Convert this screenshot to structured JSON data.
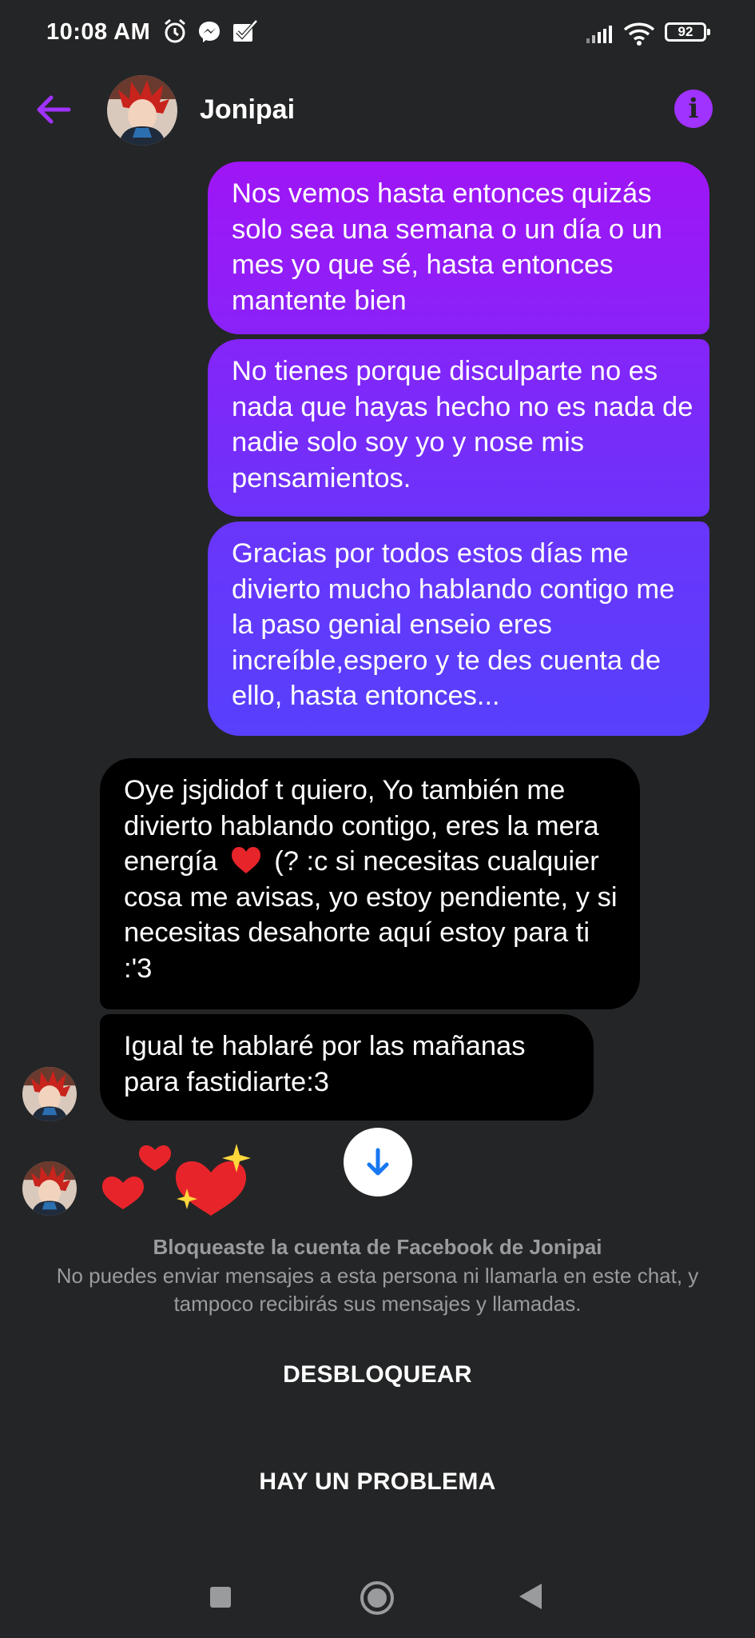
{
  "status_bar": {
    "time": "10:08 AM",
    "battery": "92",
    "icons": [
      "alarm-icon",
      "messenger-icon",
      "checkbox-icon",
      "signal-icon",
      "wifi-icon",
      "battery-icon"
    ]
  },
  "header": {
    "contact_name": "Jonipai",
    "back_icon": "arrow-left-icon",
    "info_icon": "info-icon"
  },
  "colors": {
    "accent": "#a033ff",
    "background": "#242526",
    "received_bubble": "#000000",
    "sent_gradient_top": "#9f15f6",
    "sent_gradient_bottom": "#5740fd",
    "muted_text": "#9a9b9d"
  },
  "messages": [
    {
      "direction": "sent",
      "text": "Nos vemos hasta entonces quizás solo sea una semana o un día o un mes yo que sé, hasta entonces mantente bien"
    },
    {
      "direction": "sent",
      "text": "No tienes porque disculparte no es nada que hayas hecho no es nada de nadie solo soy yo y nose mis pensamientos."
    },
    {
      "direction": "sent",
      "text": "Gracias por todos estos días me divierto mucho hablando contigo me la paso genial enseio eres increíble,espero y te des cuenta de ello, hasta entonces..."
    },
    {
      "direction": "received",
      "text_before": "Oye jsjdidof t quiero, Yo también me divierto hablando contigo, eres la mera energía",
      "emoji": "red-heart",
      "text_after": "(? :c si necesitas cualquier cosa me avisas, yo estoy pendiente, y si necesitas desahorte aquí estoy para ti :'3"
    },
    {
      "direction": "received",
      "text": "Igual te hablaré por las mañanas para fastidiarte:3"
    },
    {
      "direction": "received",
      "emoji_only": [
        "two-hearts",
        "sparkling-heart"
      ]
    }
  ],
  "blocked_notice": {
    "title": "Bloqueaste la cuenta de Facebook de Jonipai",
    "description": "No puedes enviar mensajes a esta persona ni llamarla en este chat, y tampoco recibirás sus mensajes y llamadas."
  },
  "actions": {
    "unblock": "DESBLOQUEAR",
    "report_problem": "HAY UN PROBLEMA"
  },
  "scroll_down_icon": "arrow-down-icon",
  "nav_bar": [
    "recent-apps-icon",
    "home-icon",
    "back-triangle-icon"
  ]
}
